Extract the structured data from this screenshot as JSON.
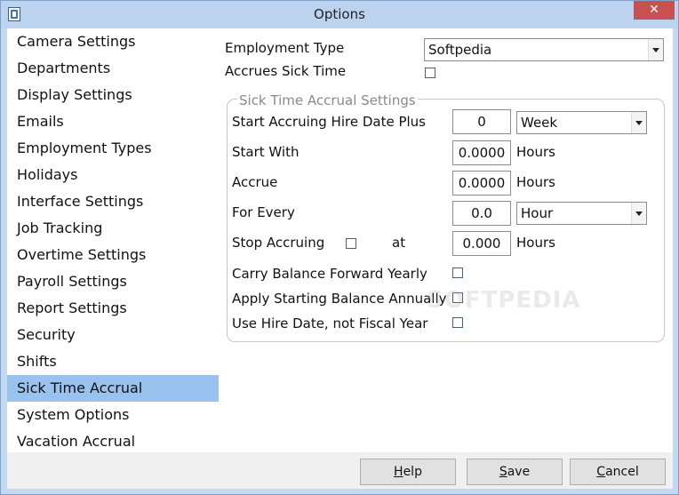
{
  "window": {
    "title": "Options",
    "close_glyph": "✕"
  },
  "sidebar": {
    "items": [
      {
        "label": "Camera Settings"
      },
      {
        "label": "Departments"
      },
      {
        "label": "Display Settings"
      },
      {
        "label": "Emails"
      },
      {
        "label": "Employment Types"
      },
      {
        "label": "Holidays"
      },
      {
        "label": "Interface Settings"
      },
      {
        "label": "Job Tracking"
      },
      {
        "label": "Overtime Settings"
      },
      {
        "label": "Payroll Settings"
      },
      {
        "label": "Report Settings"
      },
      {
        "label": "Security"
      },
      {
        "label": "Shifts"
      },
      {
        "label": "Sick Time Accrual"
      },
      {
        "label": "System Options"
      },
      {
        "label": "Vacation Accrual"
      }
    ],
    "selected": "Sick Time Accrual"
  },
  "form": {
    "employment_type_label": "Employment Type",
    "employment_type_value": "Softpedia",
    "accrues_sick_time_label": "Accrues Sick Time",
    "accrues_sick_time_checked": false,
    "group_title": "Sick Time Accrual Settings",
    "start_accruing_label": "Start Accruing Hire Date Plus",
    "start_accruing_value": "0",
    "start_accruing_unit": "Week",
    "start_with_label": "Start With",
    "start_with_value": "0.0000",
    "start_with_unit": "Hours",
    "accrue_label": "Accrue",
    "accrue_value": "0.0000",
    "accrue_unit": "Hours",
    "for_every_label": "For Every",
    "for_every_value": "0.0",
    "for_every_unit": "Hour",
    "stop_accruing_label": "Stop Accruing",
    "stop_accruing_checked": false,
    "at_label": "at",
    "stop_at_value": "0.000",
    "stop_at_unit": "Hours",
    "carry_forward_label": "Carry Balance Forward Yearly",
    "carry_forward_checked": false,
    "apply_starting_label": "Apply Starting Balance Annually",
    "apply_starting_checked": false,
    "use_hire_date_label": "Use Hire Date, not Fiscal Year",
    "use_hire_date_checked": false
  },
  "watermark": "SOFTPEDIA",
  "buttons": {
    "help": {
      "pre": "",
      "mnemonic": "H",
      "post": "elp"
    },
    "save": {
      "pre": "",
      "mnemonic": "S",
      "post": "ave"
    },
    "cancel": {
      "pre": "",
      "mnemonic": "C",
      "post": "ancel"
    }
  }
}
